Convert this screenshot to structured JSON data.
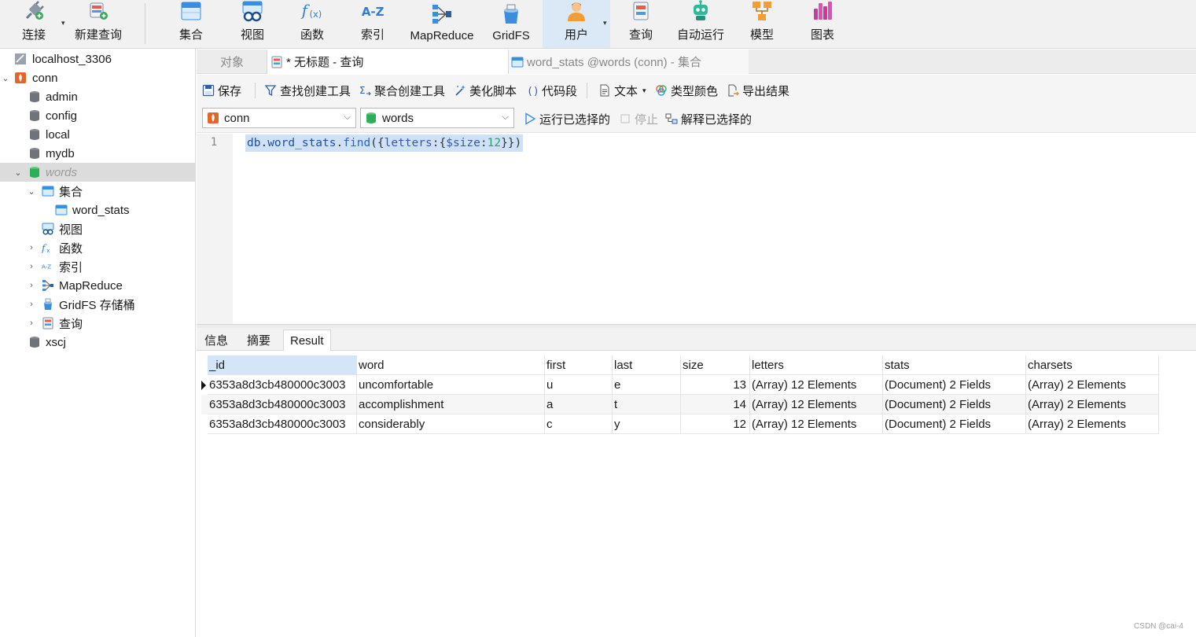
{
  "toolbar": {
    "buttons": [
      {
        "label": "连接",
        "icon": "plug-icon"
      },
      {
        "label": "新建查询",
        "icon": "new-query-icon"
      },
      {
        "label": "集合",
        "icon": "collection-icon"
      },
      {
        "label": "视图",
        "icon": "view-icon"
      },
      {
        "label": "函数",
        "icon": "function-icon"
      },
      {
        "label": "索引",
        "icon": "index-icon"
      },
      {
        "label": "MapReduce",
        "icon": "mapreduce-icon"
      },
      {
        "label": "GridFS",
        "icon": "gridfs-icon"
      },
      {
        "label": "用户",
        "icon": "user-icon"
      },
      {
        "label": "查询",
        "icon": "query-icon"
      },
      {
        "label": "自动运行",
        "icon": "robot-icon"
      },
      {
        "label": "模型",
        "icon": "model-icon"
      },
      {
        "label": "图表",
        "icon": "chart-icon"
      }
    ],
    "active": "用户"
  },
  "sidebar": {
    "items": [
      {
        "label": "localhost_3306",
        "icon": "mysql-connection-icon"
      },
      {
        "label": "conn",
        "icon": "mongodb-connection-icon"
      },
      {
        "label": "admin",
        "icon": "database-icon"
      },
      {
        "label": "config",
        "icon": "database-icon"
      },
      {
        "label": "local",
        "icon": "database-icon"
      },
      {
        "label": "mydb",
        "icon": "database-icon"
      },
      {
        "label": "words",
        "icon": "database-active-icon"
      },
      {
        "label": "集合",
        "icon": "collection-icon"
      },
      {
        "label": "word_stats",
        "icon": "collection-icon"
      },
      {
        "label": "视图",
        "icon": "view-icon"
      },
      {
        "label": "函数",
        "icon": "function-icon"
      },
      {
        "label": "索引",
        "icon": "index-icon"
      },
      {
        "label": "MapReduce",
        "icon": "mapreduce-icon"
      },
      {
        "label": "GridFS 存储桶",
        "icon": "gridfs-icon"
      },
      {
        "label": "查询",
        "icon": "query-icon"
      },
      {
        "label": "xscj",
        "icon": "database-icon"
      }
    ]
  },
  "tabs": {
    "objects": "对象",
    "query": "* 无标题 - 查询",
    "collection": "word_stats @words (conn) - 集合"
  },
  "query_toolbar": {
    "save": "保存",
    "find_builder": "查找创建工具",
    "aggregate_builder": "聚合创建工具",
    "beautify": "美化脚本",
    "snippet": "代码段",
    "text": "文本",
    "type_color": "类型颜色",
    "export": "导出结果"
  },
  "selectors": {
    "connection": "conn",
    "database": "words",
    "run_selected": "运行已选择的",
    "stop": "停止",
    "explain_selected": "解释已选择的"
  },
  "editor": {
    "line_number": "1",
    "code": {
      "obj": "db",
      "dot1": ".",
      "collection": "word_stats",
      "dot2": ".",
      "method": "find",
      "open": "({",
      "key": "letters",
      "colon1": ":",
      "brace_open": "{",
      "op": "$size",
      "colon2": ":",
      "num": "12",
      "close": "}})"
    }
  },
  "result_tabs": [
    "信息",
    "摘要",
    "Result"
  ],
  "results": {
    "columns": [
      "_id",
      "word",
      "first",
      "last",
      "size",
      "letters",
      "stats",
      "charsets"
    ],
    "rows": [
      [
        "6353a8d3cb480000c3003",
        "uncomfortable",
        "u",
        "e",
        "13",
        "(Array) 12 Elements",
        "(Document) 2 Fields",
        "(Array) 2 Elements"
      ],
      [
        "6353a8d3cb480000c3003",
        "accomplishment",
        "a",
        "t",
        "14",
        "(Array) 12 Elements",
        "(Document) 2 Fields",
        "(Array) 2 Elements"
      ],
      [
        "6353a8d3cb480000c3003",
        "considerably",
        "c",
        "y",
        "12",
        "(Array) 12 Elements",
        "(Document) 2 Fields",
        "(Array) 2 Elements"
      ]
    ]
  },
  "watermark": "CSDN @cai-4",
  "colors": {
    "accent": "#2e7dd6",
    "selection": "#cfe1f6",
    "header_sorted": "#d4e5f7",
    "database_green": "#2eae5a"
  }
}
